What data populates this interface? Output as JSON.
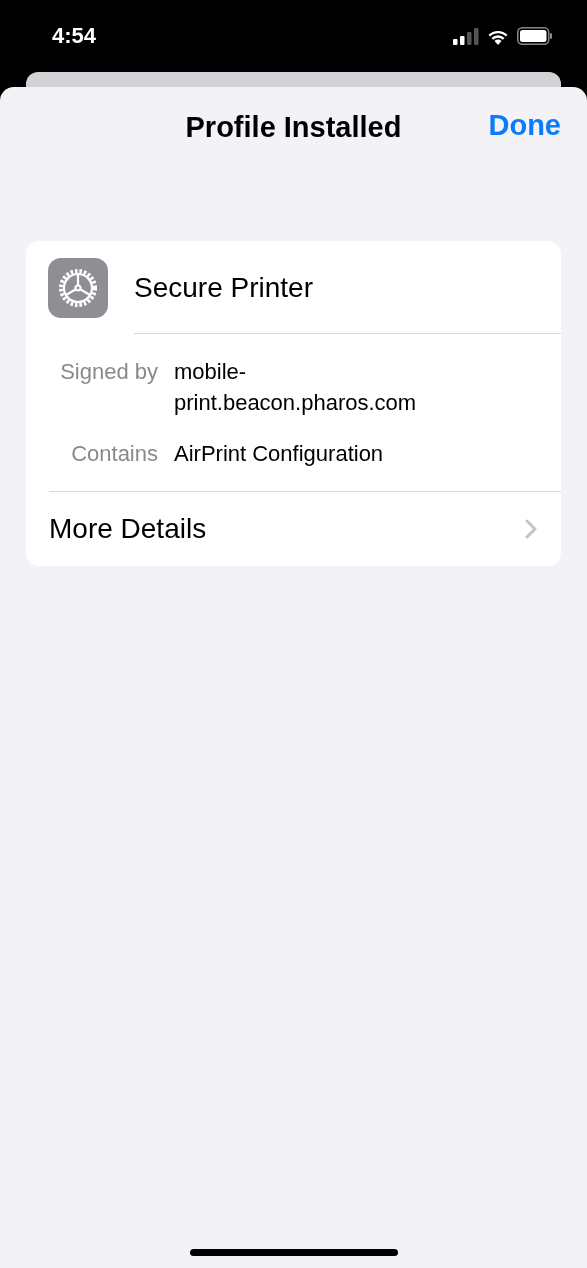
{
  "status_bar": {
    "time": "4:54"
  },
  "nav": {
    "title": "Profile Installed",
    "done": "Done"
  },
  "profile": {
    "name": "Secure Printer",
    "details": [
      {
        "label": "Signed by",
        "value": "mobile-\nprint.beacon.pharos.com"
      },
      {
        "label": "Contains",
        "value": "AirPrint Configuration"
      }
    ],
    "more": "More Details"
  }
}
